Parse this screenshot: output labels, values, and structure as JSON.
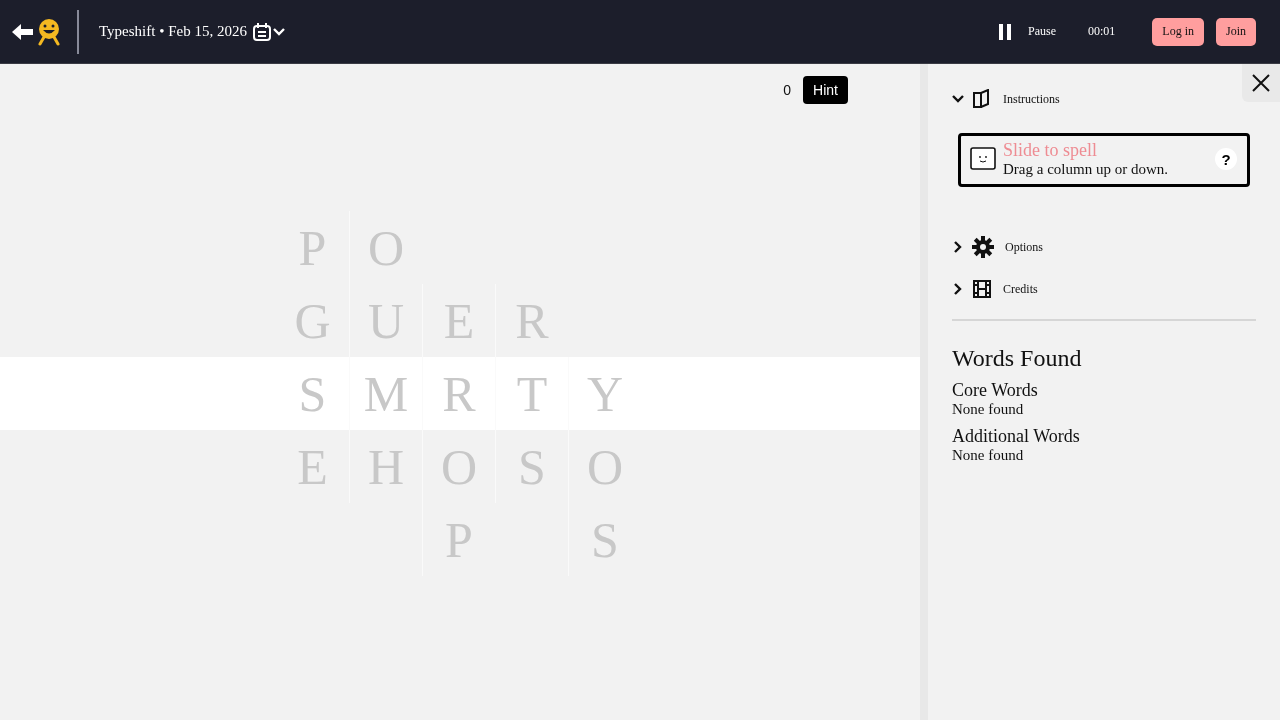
{
  "header": {
    "title": "Typeshift • Feb 15, 2026",
    "pause_label": "Pause",
    "timer": "00:01",
    "login": "Log in",
    "join": "Join"
  },
  "game": {
    "hint_count": "0",
    "hint_label": "Hint",
    "rows": [
      {
        "selected": false,
        "cells": [
          "P",
          "O",
          null,
          null,
          null
        ]
      },
      {
        "selected": false,
        "cells": [
          "G",
          "U",
          "E",
          "R",
          null
        ]
      },
      {
        "selected": true,
        "cells": [
          "S",
          "M",
          "R",
          "T",
          "Y"
        ]
      },
      {
        "selected": false,
        "cells": [
          "E",
          "H",
          "O",
          "S",
          "O"
        ]
      },
      {
        "selected": false,
        "cells": [
          null,
          null,
          "P",
          null,
          "S"
        ]
      }
    ]
  },
  "sidebar": {
    "sections": [
      {
        "kind": "book",
        "label": "Instructions",
        "expanded": true
      },
      {
        "kind": "gear",
        "label": "Options",
        "expanded": false
      },
      {
        "kind": "film",
        "label": "Credits",
        "expanded": false
      }
    ],
    "instruction_card": {
      "title": "Slide to spell",
      "text": "Drag a column up or down.",
      "help": "?"
    },
    "words_found": {
      "title": "Words Found",
      "groups": [
        {
          "title": "Core Words",
          "text": "None found"
        },
        {
          "title": "Additional Words",
          "text": "None found"
        }
      ]
    }
  }
}
